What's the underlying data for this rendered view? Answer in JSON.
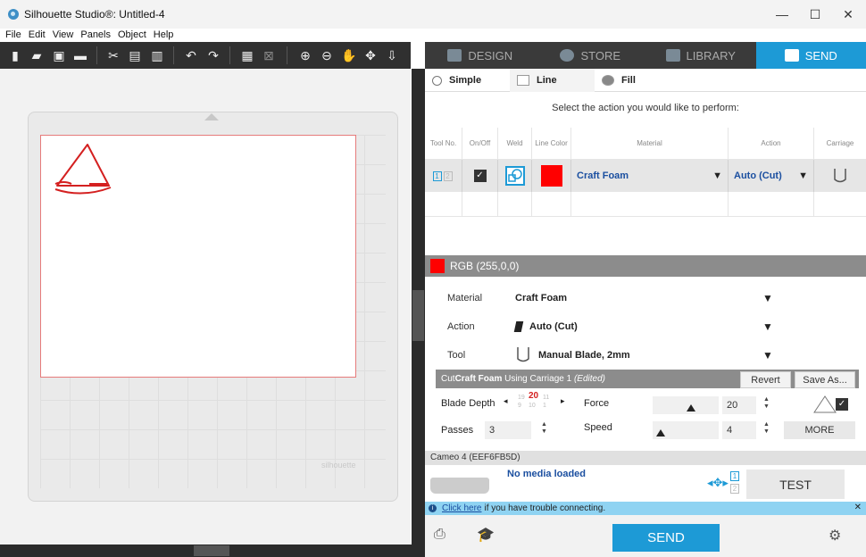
{
  "window": {
    "title": "Silhouette Studio®: Untitled-4",
    "minimize": "—",
    "maximize": "☐",
    "close": "✕"
  },
  "menu": [
    "File",
    "Edit",
    "View",
    "Panels",
    "Object",
    "Help"
  ],
  "nav_tabs": [
    {
      "label": "DESIGN",
      "icon": "design-icon"
    },
    {
      "label": "STORE",
      "icon": "store-icon"
    },
    {
      "label": "LIBRARY",
      "icon": "library-icon"
    },
    {
      "label": "SEND",
      "icon": "send-icon",
      "active": true
    }
  ],
  "mode_tabs": [
    "Simple",
    "Line",
    "Fill"
  ],
  "instruction": "Select the action you would like to perform:",
  "table": {
    "headers": [
      "Tool No.",
      "On/Off",
      "Weld",
      "Line Color",
      "Material",
      "Action",
      "Carriage"
    ],
    "row": {
      "tool_nums": [
        "1",
        "2"
      ],
      "material": "Craft Foam",
      "action": "Auto (Cut)",
      "line_color": "#ff0000"
    }
  },
  "color_section": {
    "label": "RGB (255,0,0)",
    "color": "#ff0000"
  },
  "settings": {
    "material_label": "Material",
    "material_value": "Craft Foam",
    "action_label": "Action",
    "action_value": "Auto (Cut)",
    "tool_label": "Tool",
    "tool_value": "Manual Blade, 2mm"
  },
  "cut": {
    "header_prefix": "Cut ",
    "header_material": "Craft Foam",
    "header_middle": " Using Carriage 1 ",
    "header_edited": "(Edited)",
    "revert": "Revert",
    "save_as": "Save As...",
    "blade_depth_label": "Blade Depth",
    "blade_values": [
      "19",
      "20",
      "11"
    ],
    "blade_values_lower": [
      "9",
      "10",
      "1"
    ],
    "force_label": "Force",
    "force_value": "20",
    "passes_label": "Passes",
    "passes_value": "3",
    "speed_label": "Speed",
    "speed_value": "4",
    "more": "MORE"
  },
  "device": {
    "name": "Cameo 4 (EEF6FB5D)",
    "status": "No media loaded",
    "test": "TEST"
  },
  "info": {
    "link": "Click here",
    "text": "if you have trouble connecting."
  },
  "send": "SEND",
  "mat_logo": "silhouette",
  "colors": {
    "accent": "#1d9ad6",
    "toolbar": "#303030",
    "line": "#ff0000"
  }
}
